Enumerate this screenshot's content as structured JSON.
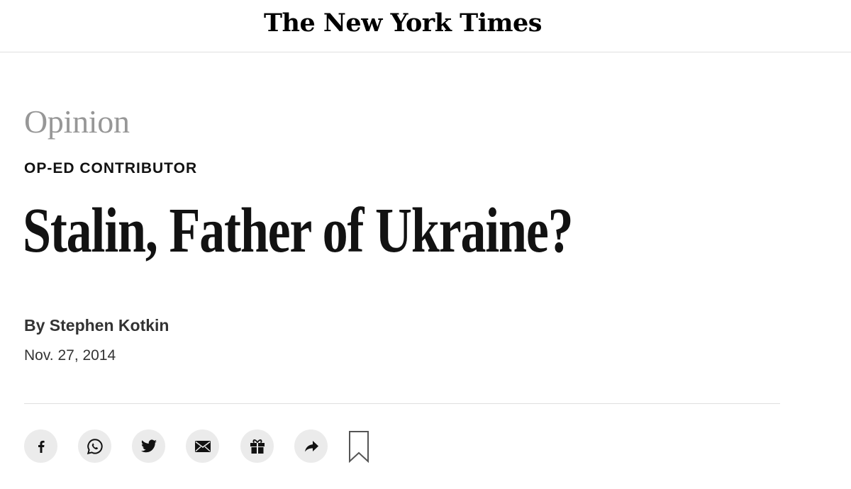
{
  "masthead": {
    "logo_text": "The New York Times"
  },
  "article": {
    "section": "Opinion",
    "kicker": "OP-ED CONTRIBUTOR",
    "headline": "Stalin, Father of Ukraine?",
    "byline": "By Stephen Kotkin",
    "date": "Nov. 27, 2014"
  },
  "share_tools": [
    {
      "name": "facebook",
      "icon": "facebook-icon"
    },
    {
      "name": "whatsapp",
      "icon": "whatsapp-icon"
    },
    {
      "name": "twitter",
      "icon": "twitter-icon"
    },
    {
      "name": "email",
      "icon": "mail-icon"
    },
    {
      "name": "gift",
      "icon": "gift-icon"
    },
    {
      "name": "share",
      "icon": "share-arrow-icon"
    },
    {
      "name": "save",
      "icon": "bookmark-icon"
    }
  ],
  "colors": {
    "text_primary": "#121212",
    "section_gray": "#979797",
    "byline_gray": "#333333",
    "rule_gray": "#dfdfdf",
    "button_bg": "#ebebeb"
  }
}
